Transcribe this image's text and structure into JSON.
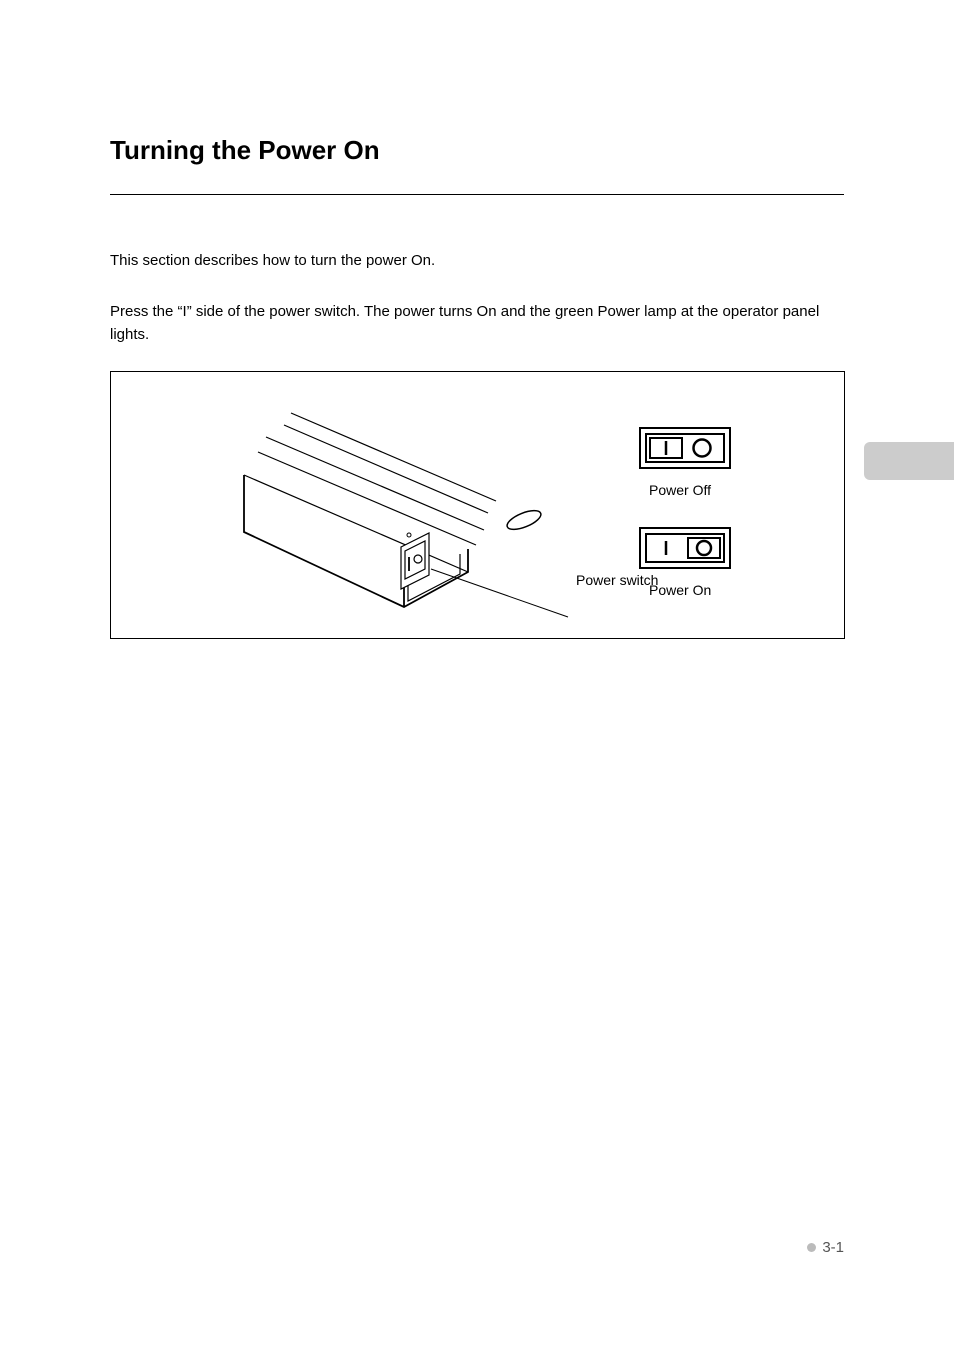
{
  "section": {
    "title": "Turning the Power On",
    "intro": "This section describes how to turn the power On.",
    "instruction": "Press the “I” side of the power switch.  The power turns On and the green Power lamp at the operator panel lights."
  },
  "figure": {
    "labels": {
      "power_switch": "Power switch",
      "power_off": "Power Off",
      "power_on": "Power On"
    }
  },
  "page_number": "3-1"
}
